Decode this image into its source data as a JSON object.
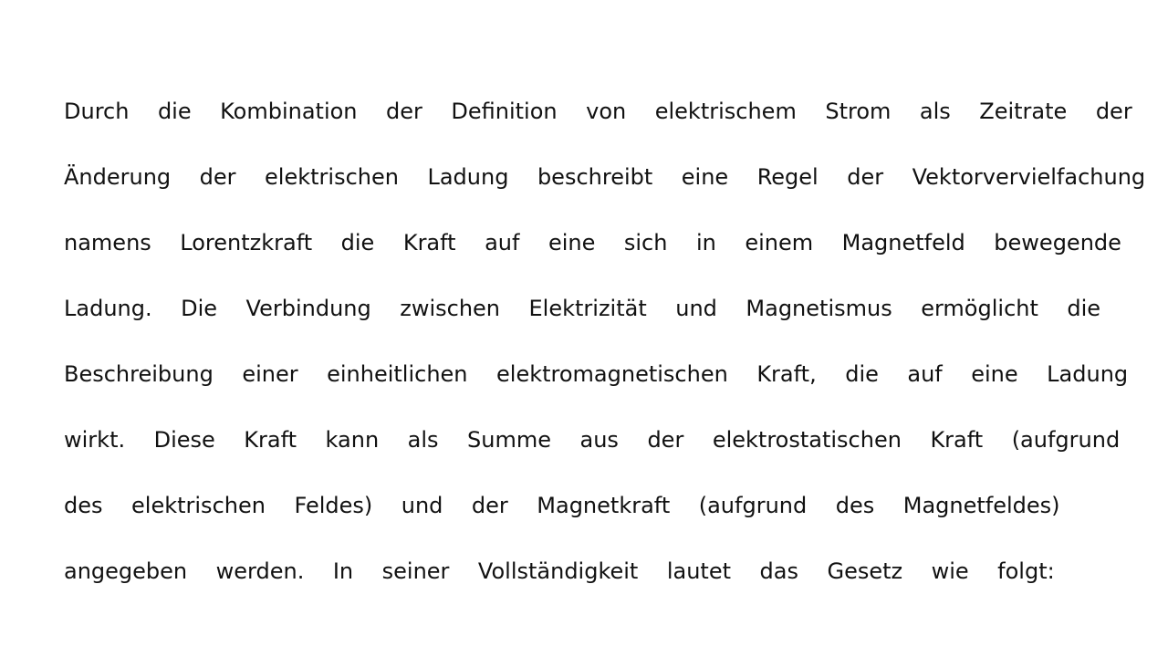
{
  "document": {
    "lines": [
      {
        "words": [
          "Durch",
          "die",
          "Kombination",
          "der",
          "Definition",
          "von",
          "elektrischem",
          "Strom",
          "als",
          "Zeitrate",
          "der"
        ]
      },
      {
        "words": [
          "Änderung",
          "der",
          "elektrischen",
          "Ladung",
          "beschreibt",
          "eine",
          "Regel",
          "der",
          "Vektorvervielfachung"
        ]
      },
      {
        "words": [
          "namens",
          "Lorentzkraft",
          "die",
          "Kraft",
          "auf",
          "eine",
          "sich",
          "in",
          "einem",
          "Magnetfeld",
          "bewegende"
        ]
      },
      {
        "words": [
          "Ladung.",
          "Die",
          "Verbindung",
          "zwischen",
          "Elektrizität",
          "und",
          "Magnetismus",
          "ermöglicht",
          "die"
        ]
      },
      {
        "words": [
          "Beschreibung",
          "einer",
          "einheitlichen",
          "elektromagnetischen",
          "Kraft,",
          "die",
          "auf",
          "eine",
          "Ladung"
        ]
      },
      {
        "words": [
          "wirkt.",
          "Diese",
          "Kraft",
          "kann",
          "als",
          "Summe",
          "aus",
          "der",
          "elektrostatischen",
          "Kraft",
          "(aufgrund"
        ]
      },
      {
        "words": [
          "des",
          "elektrischen",
          "Feldes)",
          "und",
          "der",
          "Magnetkraft",
          "(aufgrund",
          "des",
          "Magnetfeldes)"
        ]
      },
      {
        "words": [
          "angegeben",
          "werden.",
          "In",
          "seiner",
          "Vollständigkeit",
          "lautet",
          "das",
          "Gesetz",
          "wie",
          "folgt:"
        ]
      }
    ]
  }
}
